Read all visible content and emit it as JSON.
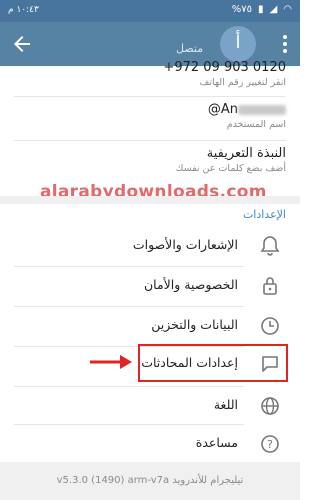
{
  "status_bar": {
    "time": "١٠:٤٣ م",
    "battery": "%٧٥"
  },
  "header": {
    "avatar_letter": "أ",
    "status": "متصل"
  },
  "profile": {
    "phone_value": "+972 09 903 0120",
    "phone_hint": "انقر لتغيير رقم الهاتف",
    "username_value": "@An",
    "username_hint": "اسم المستخدم",
    "bio_value": "النبذة التعريفية",
    "bio_hint": "أضف بضع كلمات عن نفسك"
  },
  "watermark": "alarabydownloads.com",
  "settings": {
    "title": "الإعدادات",
    "items": [
      {
        "label": "الإشعارات والأصوات",
        "icon": "bell-icon"
      },
      {
        "label": "الخصوصية والأمان",
        "icon": "lock-icon"
      },
      {
        "label": "البيانات والتخزين",
        "icon": "clock-icon"
      },
      {
        "label": "إعدادات المحادثات",
        "icon": "chat-bubble-icon"
      },
      {
        "label": "اللغة",
        "icon": "globe-icon"
      },
      {
        "label": "مساعدة",
        "icon": "help-icon"
      }
    ]
  },
  "footer": "تيليجرام للأندرويد v5.3.0 (1490) arm-v7a",
  "colors": {
    "header": "#5682a3",
    "statusbar": "#48759e",
    "accent": "#3f86c9",
    "highlight": "#e02424"
  }
}
